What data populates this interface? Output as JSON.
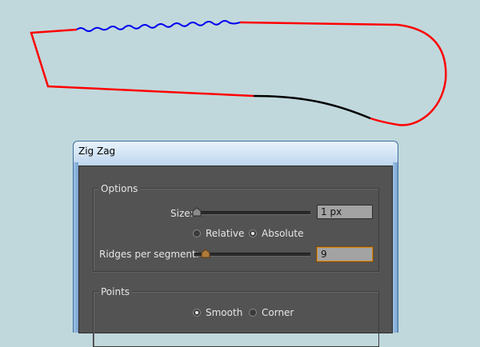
{
  "window": {
    "title": "Zig Zag"
  },
  "options_group": {
    "title": "Options",
    "size_label": "Size:",
    "size_value": "1 px",
    "relative_label": "Relative",
    "absolute_label": "Absolute",
    "ridges_label": "Ridges per segment:",
    "ridges_value": "9",
    "selected_mode": "absolute"
  },
  "points_group": {
    "title": "Points",
    "smooth_label": "Smooth",
    "corner_label": "Corner",
    "selected": "smooth"
  },
  "colors": {
    "path_red": "#ff0000",
    "path_blue": "#0000ee",
    "path_black": "#000000",
    "canvas_bg": "#c0d8dc",
    "panel_bg": "#535353",
    "focus_orange": "#d98a1e"
  }
}
